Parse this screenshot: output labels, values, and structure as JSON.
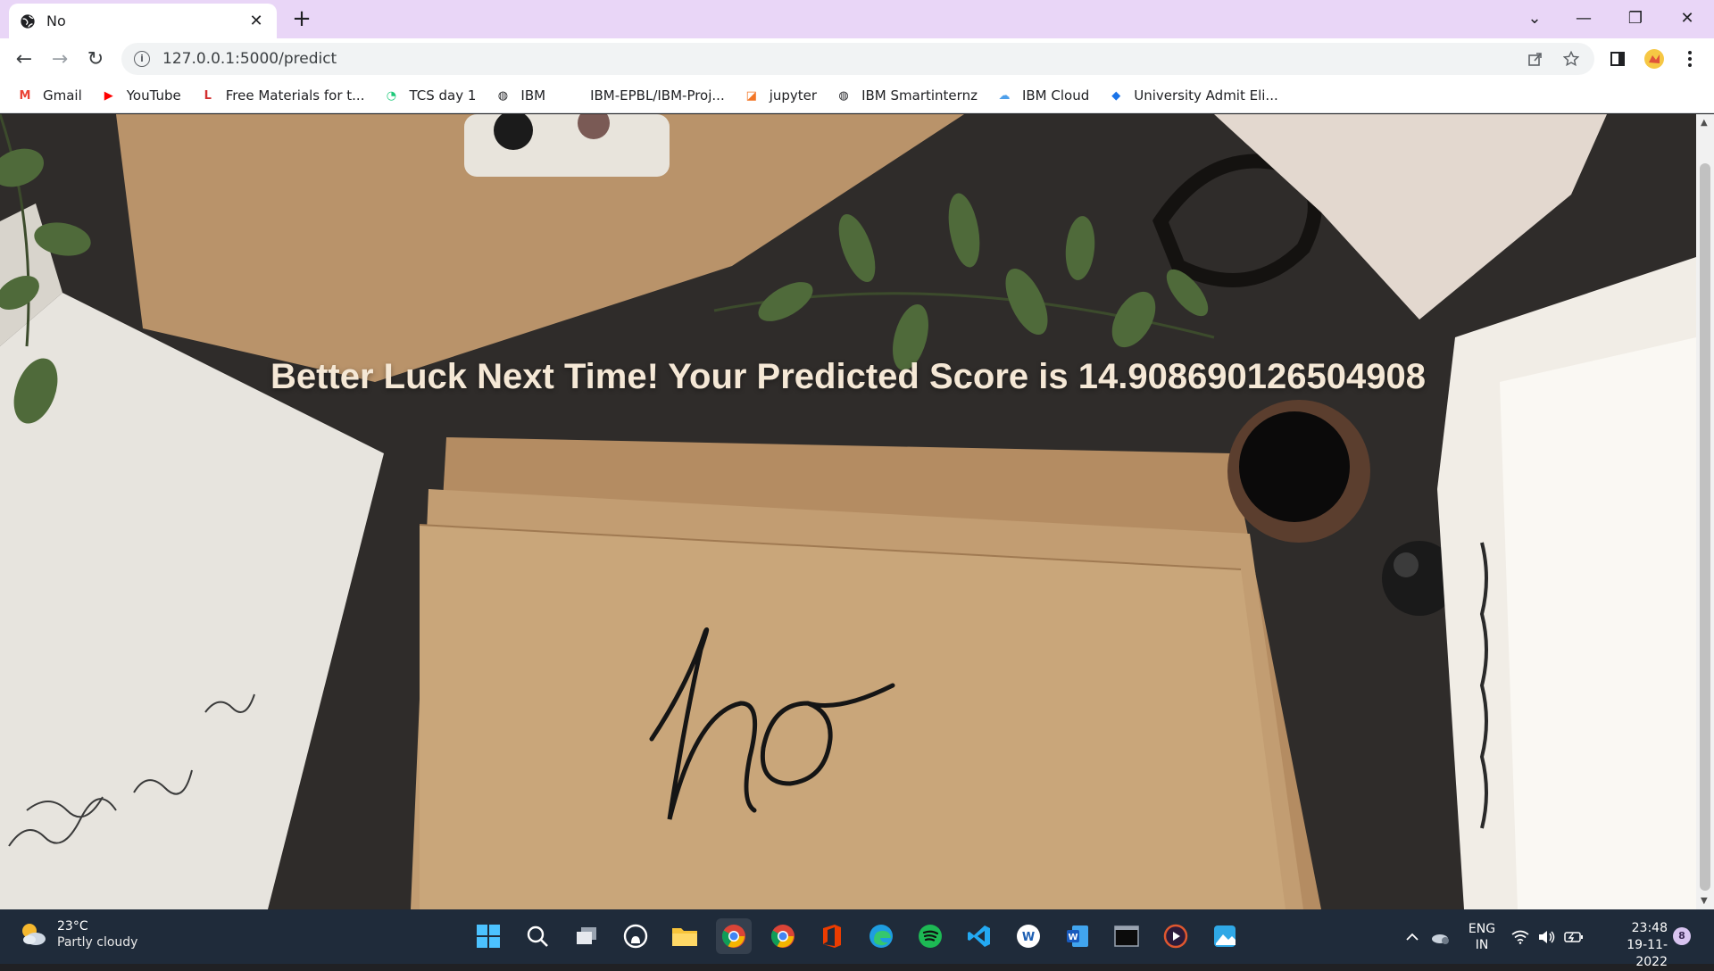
{
  "tab": {
    "title": "No",
    "close_glyph": "✕",
    "favicon": "globe-icon"
  },
  "new_tab_glyph": "+",
  "window_controls": {
    "tabsearch": "⌄",
    "minimize": "—",
    "restore": "❐",
    "close": "✕"
  },
  "toolbar": {
    "back": "←",
    "forward": "→",
    "reload": "↻",
    "info": "i",
    "url": "127.0.0.1:5000/predict"
  },
  "bookmarks": [
    {
      "label": "Gmail",
      "icon": "gmail-icon",
      "glyph": "M",
      "color": "#ea4335"
    },
    {
      "label": "YouTube",
      "icon": "youtube-icon",
      "glyph": "▶",
      "color": "#ff0000"
    },
    {
      "label": "Free Materials for t...",
      "icon": "l-logo-icon",
      "glyph": "L",
      "color": "#d32f2f"
    },
    {
      "label": "TCS day 1",
      "icon": "tcs-icon",
      "glyph": "◔",
      "color": "#1ec97a"
    },
    {
      "label": "IBM",
      "icon": "globe-icon",
      "glyph": "◍",
      "color": "#202124"
    },
    {
      "label": "IBM-EPBL/IBM-Proj...",
      "icon": "github-icon",
      "glyph": "",
      "color": "#202124"
    },
    {
      "label": "jupyter",
      "icon": "jupyter-icon",
      "glyph": "◪",
      "color": "#f37626"
    },
    {
      "label": "IBM Smartinternz",
      "icon": "globe-icon",
      "glyph": "◍",
      "color": "#202124"
    },
    {
      "label": "IBM Cloud",
      "icon": "cloud-icon",
      "glyph": "☁",
      "color": "#4e9fea"
    },
    {
      "label": "University Admit Eli...",
      "icon": "diamond-icon",
      "glyph": "◆",
      "color": "#1a73e8"
    }
  ],
  "main": {
    "result_text": "Better Luck Next Time! Your Predicted Score is 14.908690126504908",
    "photo_text": "no"
  },
  "weather": {
    "temp": "23°C",
    "desc": "Partly cloudy"
  },
  "tray": {
    "lang": "ENG",
    "region": "IN",
    "time": "23:48",
    "date": "19-11-2022",
    "notifications": "8"
  },
  "colors": {
    "tabstrip": "#e9d6f7",
    "taskbar": "#1f2b3a",
    "result_text": "#f5e8d6"
  }
}
